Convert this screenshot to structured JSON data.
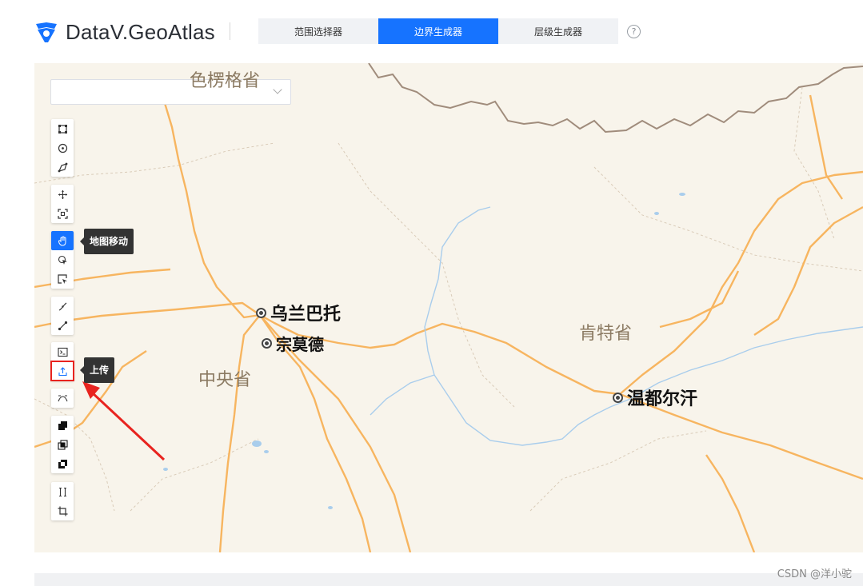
{
  "header": {
    "brand": "DataV.GeoAtlas",
    "tabs": [
      {
        "label": "范围选择器",
        "active": false
      },
      {
        "label": "边界生成器",
        "active": true
      },
      {
        "label": "层级生成器",
        "active": false
      }
    ],
    "help_symbol": "?"
  },
  "map": {
    "select": {
      "value": ""
    },
    "places": [
      {
        "name": "乌兰巴托"
      },
      {
        "name": "宗莫德"
      },
      {
        "name": "温都尔汗"
      }
    ],
    "provinces": [
      {
        "name": "肯特省"
      },
      {
        "name": "中央省"
      },
      {
        "name": "色楞格省"
      }
    ],
    "toolbar": {
      "tooltips": {
        "pan": "地图移动",
        "upload": "上传"
      },
      "groups": [
        [
          "rectangle-select-icon",
          "circle-select-icon",
          "polygon-select-icon"
        ],
        [
          "move-icon",
          "fit-view-icon"
        ],
        [
          "hand-pan-icon",
          "point-select-icon",
          "box-select-icon"
        ],
        [
          "line-draw-icon",
          "segment-icon"
        ],
        [
          "terminal-icon",
          "upload-icon"
        ],
        [
          "curve-icon"
        ],
        [
          "union-icon",
          "intersect-icon",
          "difference-icon"
        ],
        [
          "split-icon",
          "crop-icon"
        ]
      ],
      "active": "hand-pan-icon",
      "highlighted": "upload-icon"
    }
  },
  "watermark": "CSDN @洋小驼",
  "colors": {
    "primary": "#1673ff",
    "annotation": "#e8231f",
    "road": "#f7b560",
    "river": "#a9cdec",
    "border": "#a08c7c"
  }
}
